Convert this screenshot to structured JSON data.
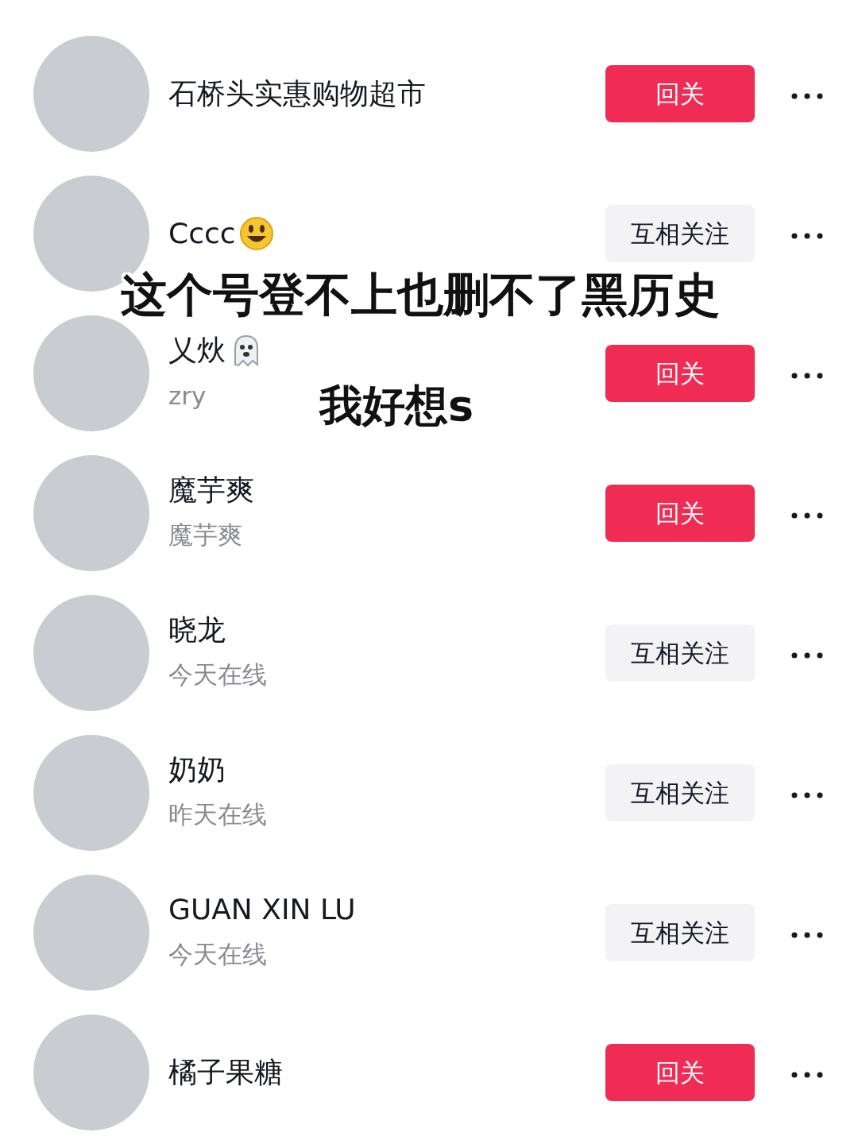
{
  "users": [
    {
      "name": "石桥头实惠购物超市",
      "button": {
        "label": "回关",
        "kind": "follow_back"
      }
    },
    {
      "name": "Cccc",
      "emoji": {
        "kind": "smiley"
      },
      "button": {
        "label": "互相关注",
        "kind": "mutual"
      }
    },
    {
      "name": "乂炏",
      "emoji": {
        "kind": "ghost"
      },
      "subtitle": "zry",
      "button": {
        "label": "回关",
        "kind": "follow_back"
      }
    },
    {
      "name": "魔芋爽",
      "subtitle": "魔芋爽",
      "button": {
        "label": "回关",
        "kind": "follow_back"
      }
    },
    {
      "name": "晓龙",
      "subtitle": "今天在线",
      "button": {
        "label": "互相关注",
        "kind": "mutual"
      }
    },
    {
      "name": "奶奶",
      "subtitle": "昨天在线",
      "button": {
        "label": "互相关注",
        "kind": "mutual"
      }
    },
    {
      "name": "GUAN XIN LU",
      "subtitle": "今天在线",
      "button": {
        "label": "互相关注",
        "kind": "mutual"
      }
    },
    {
      "name": "橘子果糖",
      "button": {
        "label": "回关",
        "kind": "follow_back"
      }
    }
  ],
  "captions": [
    "这个号登不上也删不了黑历史",
    "我好想s"
  ]
}
